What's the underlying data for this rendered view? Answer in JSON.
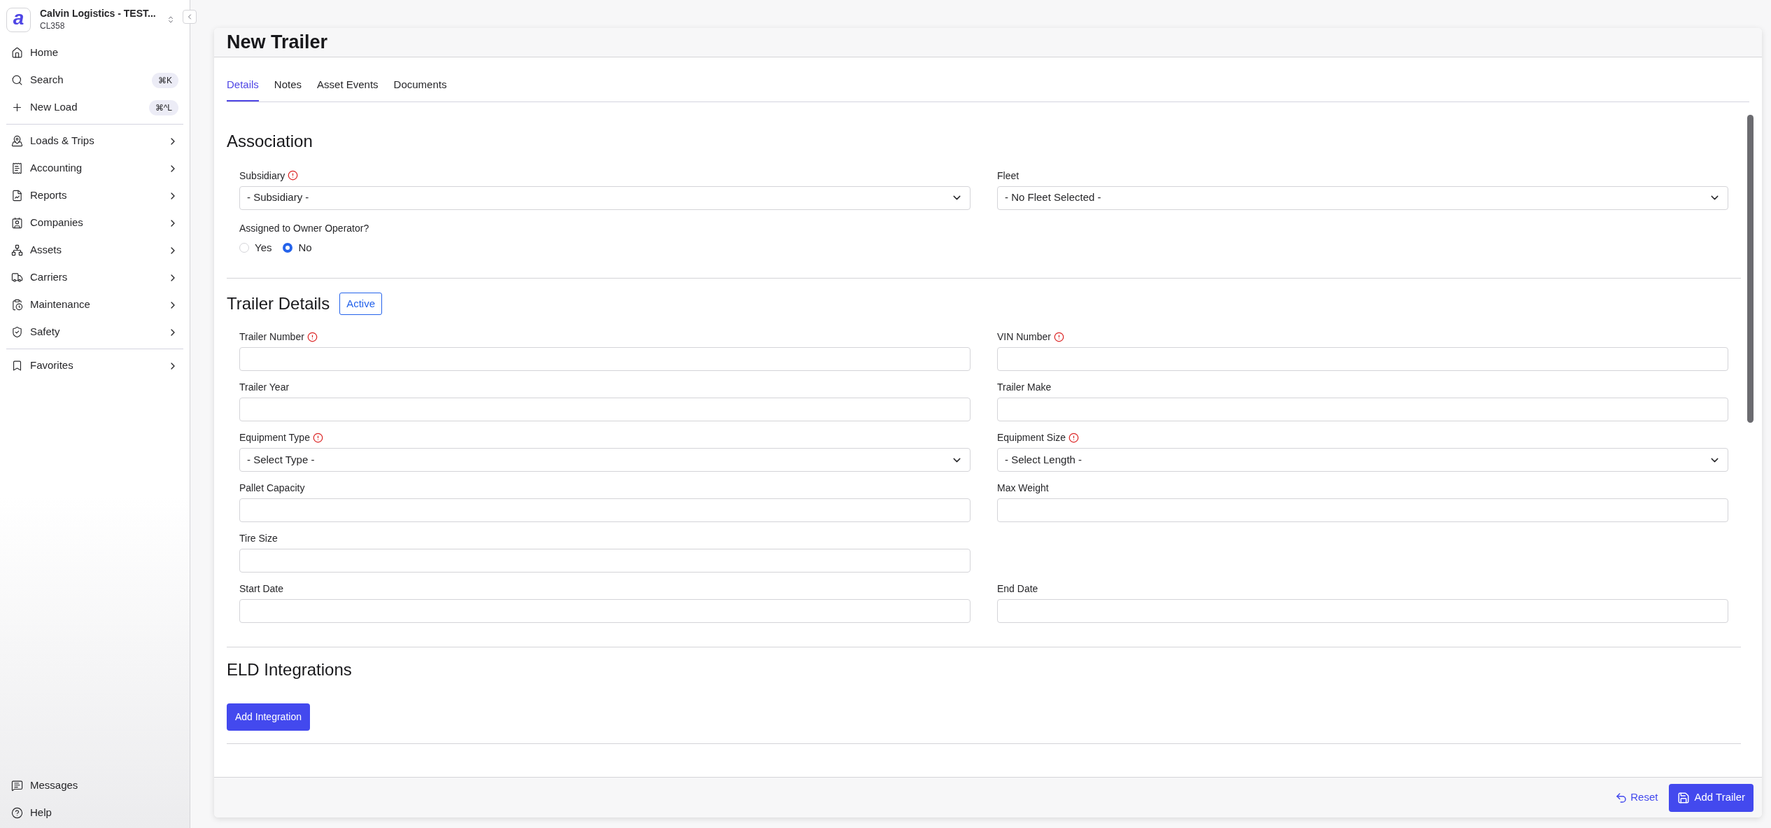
{
  "sidebar": {
    "org": {
      "name": "Calvin Logistics - TEST...",
      "code": "CL358",
      "logo": "a"
    },
    "top_items": [
      {
        "label": "Home"
      },
      {
        "label": "Search",
        "shortcut": "⌘K"
      },
      {
        "label": "New Load",
        "shortcut": "⌘^L"
      }
    ],
    "nav_items": [
      {
        "label": "Loads & Trips"
      },
      {
        "label": "Accounting"
      },
      {
        "label": "Reports"
      },
      {
        "label": "Companies"
      },
      {
        "label": "Assets"
      },
      {
        "label": "Carriers"
      },
      {
        "label": "Maintenance"
      },
      {
        "label": "Safety"
      }
    ],
    "fav_items": [
      {
        "label": "Favorites"
      }
    ],
    "bottom_items": [
      {
        "label": "Messages"
      },
      {
        "label": "Help"
      }
    ]
  },
  "page": {
    "title": "New Trailer",
    "tabs": [
      {
        "label": "Details",
        "selected": true
      },
      {
        "label": "Notes",
        "selected": false
      },
      {
        "label": "Asset Events",
        "selected": false
      },
      {
        "label": "Documents",
        "selected": false
      }
    ],
    "association": {
      "heading": "Association",
      "rows": [
        [
          {
            "label": "Subsidiary",
            "required": true,
            "kind": "select",
            "value": "- Subsidiary -"
          },
          {
            "label": "Fleet",
            "required": false,
            "kind": "select",
            "value": "- No Fleet Selected -"
          }
        ]
      ],
      "owner_operator": {
        "label": "Assigned to Owner Operator?",
        "options": [
          {
            "label": "Yes",
            "selected": false
          },
          {
            "label": "No",
            "selected": true
          }
        ]
      }
    },
    "trailer_details": {
      "heading": "Trailer Details",
      "status": "Active",
      "rows": [
        [
          {
            "label": "Trailer Number",
            "required": true,
            "kind": "input"
          },
          {
            "label": "VIN Number",
            "required": true,
            "kind": "input"
          }
        ],
        [
          {
            "label": "Trailer Year",
            "required": false,
            "kind": "input"
          },
          {
            "label": "Trailer Make",
            "required": false,
            "kind": "input"
          }
        ],
        [
          {
            "label": "Equipment Type",
            "required": true,
            "kind": "select",
            "value": "- Select Type -"
          },
          {
            "label": "Equipment Size",
            "required": true,
            "kind": "select",
            "value": "- Select Length -"
          }
        ],
        [
          {
            "label": "Pallet Capacity",
            "required": false,
            "kind": "input"
          },
          {
            "label": "Max Weight",
            "required": false,
            "kind": "input"
          }
        ],
        [
          {
            "label": "Tire Size",
            "required": false,
            "kind": "input"
          }
        ],
        [
          {
            "label": "Start Date",
            "required": false,
            "kind": "input"
          },
          {
            "label": "End Date",
            "required": false,
            "kind": "input"
          }
        ]
      ]
    },
    "eld": {
      "heading": "ELD Integrations",
      "button": "Add Integration"
    },
    "footer": {
      "reset": "Reset",
      "submit": "Add Trailer"
    }
  }
}
